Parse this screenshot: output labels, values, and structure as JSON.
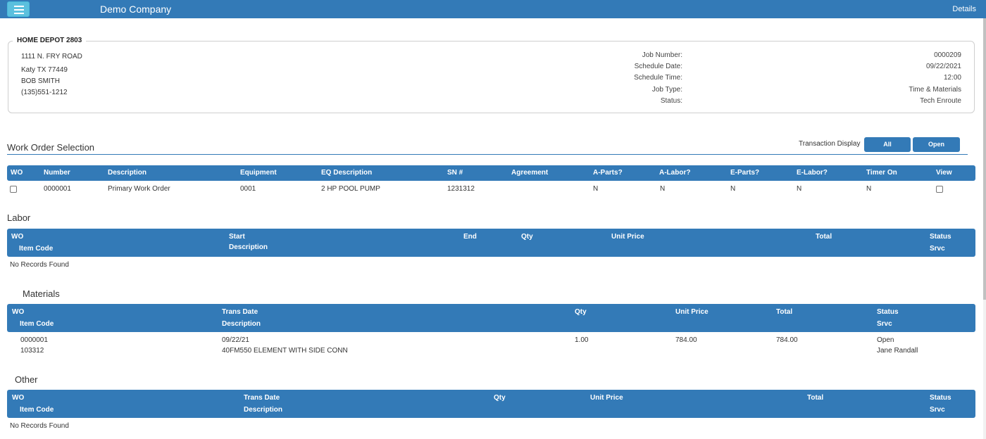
{
  "header": {
    "app_title": "Demo Company",
    "details_label": "Details"
  },
  "customer": {
    "name": "HOME DEPOT 2803",
    "address_line1": "1111 N. FRY ROAD",
    "address_line2": "Katy TX 77449",
    "contact": "BOB SMITH",
    "phone": "(135)551-1212"
  },
  "job": {
    "number_label": "Job Number:",
    "number": "0000209",
    "date_label": "Schedule Date:",
    "date": "09/22/2021",
    "time_label": "Schedule Time:",
    "time": "12:00",
    "type_label": "Job Type:",
    "type": "Time & Materials",
    "status_label": "Status:",
    "status": "Tech Enroute"
  },
  "work_orders": {
    "title": "Work Order Selection",
    "transaction_label": "Transaction Display",
    "btn_all": "All",
    "btn_open": "Open",
    "columns": [
      "WO",
      "Number",
      "Description",
      "Equipment",
      "EQ Description",
      "SN #",
      "Agreement",
      "A-Parts?",
      "A-Labor?",
      "E-Parts?",
      "E-Labor?",
      "Timer On",
      "View"
    ],
    "rows": [
      {
        "number": "0000001",
        "description": "Primary Work Order",
        "equipment": "0001",
        "eq_description": "2 HP POOL PUMP",
        "sn": "1231312",
        "agreement": "",
        "a_parts": "N",
        "a_labor": "N",
        "e_parts": "N",
        "e_labor": "N",
        "timer_on": "N"
      }
    ]
  },
  "labor": {
    "title": "Labor",
    "columns": {
      "wo": "WO",
      "item_code": "Item Code",
      "start": "Start",
      "description": "Description",
      "end": "End",
      "qty": "Qty",
      "unit_price": "Unit Price",
      "total": "Total",
      "status": "Status",
      "srvc": "Srvc"
    },
    "empty_text": "No Records Found"
  },
  "materials": {
    "title": "Materials",
    "columns": {
      "wo": "WO",
      "item_code": "Item Code",
      "trans_date": "Trans Date",
      "description": "Description",
      "qty": "Qty",
      "unit_price": "Unit Price",
      "total": "Total",
      "status": "Status",
      "srvc": "Srvc"
    },
    "rows": [
      {
        "wo": "0000001",
        "item_code": "103312",
        "trans_date": "09/22/21",
        "description": "40FM550 ELEMENT WITH SIDE CONN",
        "qty": "1.00",
        "unit_price": "784.00",
        "total": "784.00",
        "status": "Open",
        "srvc": "Jane Randall"
      }
    ]
  },
  "other": {
    "title": "Other",
    "columns": {
      "wo": "WO",
      "item_code": "Item Code",
      "trans_date": "Trans Date",
      "description": "Description",
      "qty": "Qty",
      "unit_price": "Unit Price",
      "total": "Total",
      "status": "Status",
      "srvc": "Srvc"
    },
    "empty_text": "No Records Found"
  }
}
